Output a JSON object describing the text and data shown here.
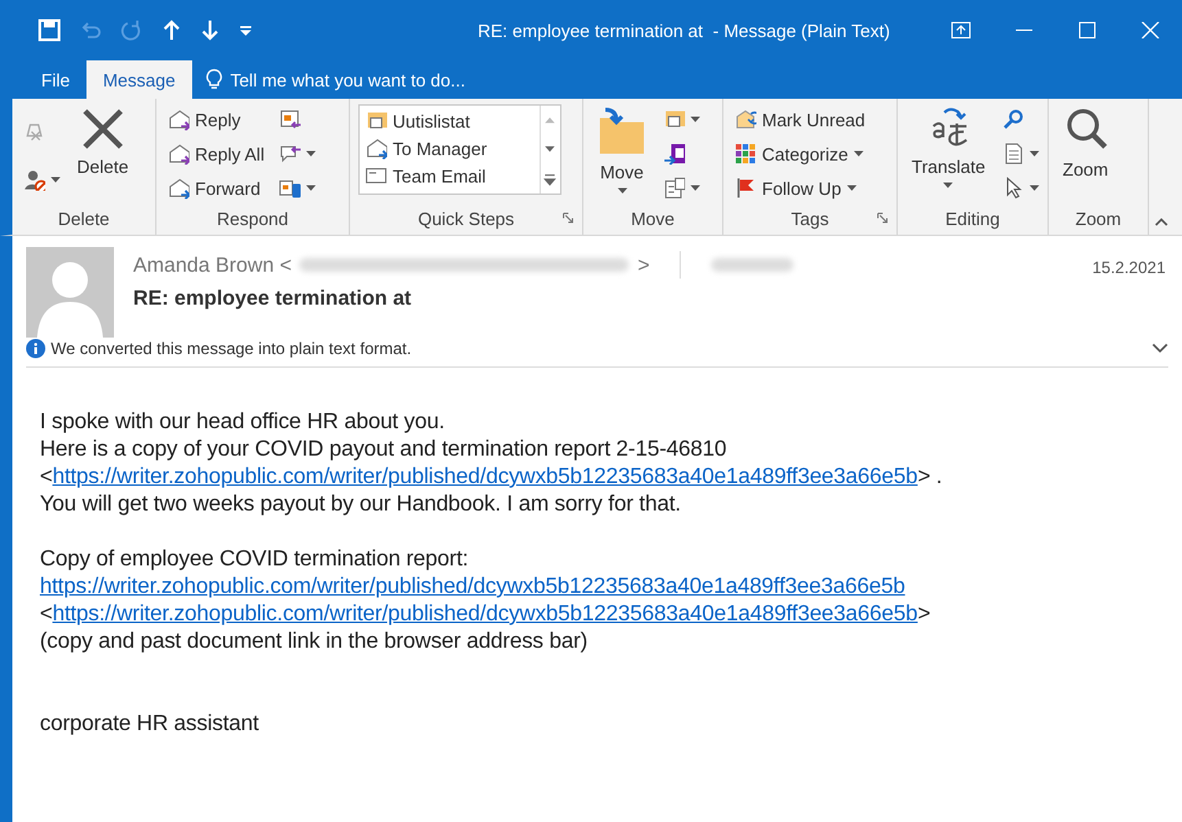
{
  "window": {
    "title": "RE: employee termination at  - Message (Plain Text)"
  },
  "tabs": [
    {
      "label": "File",
      "selected": false
    },
    {
      "label": "Message",
      "selected": true
    }
  ],
  "tell_me": {
    "placeholder": "Tell me what you want to do..."
  },
  "ribbon": {
    "groups": [
      {
        "label": "Delete",
        "buttons": [
          "Delete"
        ]
      },
      {
        "label": "Respond",
        "buttons": [
          "Reply",
          "Reply All",
          "Forward"
        ]
      },
      {
        "label": "Quick Steps",
        "buttons": [
          "Uutislistat",
          "To Manager",
          "Team Email"
        ]
      },
      {
        "label": "Move",
        "buttons": [
          "Move"
        ]
      },
      {
        "label": "Tags",
        "buttons": [
          "Mark Unread",
          "Categorize",
          "Follow Up"
        ]
      },
      {
        "label": "Editing",
        "buttons": [
          "Translate"
        ]
      },
      {
        "label": "Zoom",
        "buttons": [
          "Zoom"
        ]
      }
    ]
  },
  "message": {
    "sender": "Amanda Brown <",
    "sender_end": ">",
    "date": "15.2.2021",
    "subject": "RE: employee termination at",
    "info": "We converted this message into plain text format."
  },
  "body": {
    "paragraphs": [
      [
        [
          {
            "kind": "text",
            "text": "I spoke with our head office HR about you."
          }
        ],
        [
          {
            "kind": "text",
            "text": "Here is a copy of your COVID payout and termination report 2-15-46810"
          }
        ],
        [
          {
            "kind": "text",
            "text": "<"
          },
          {
            "kind": "link",
            "text": "https://writer.zohopublic.com/writer/published/dcywxb5b12235683a40e1a489ff3ee3a66e5b"
          },
          {
            "kind": "text",
            "text": "> ."
          }
        ],
        [
          {
            "kind": "text",
            "text": "You will get two weeks payout by our Handbook. I am sorry for that."
          }
        ]
      ],
      [
        [
          {
            "kind": "text",
            "text": "Copy of employee COVID termination report:"
          }
        ],
        [
          {
            "kind": "link",
            "text": "https://writer.zohopublic.com/writer/published/dcywxb5b12235683a40e1a489ff3ee3a66e5b"
          }
        ],
        [
          {
            "kind": "text",
            "text": "<"
          },
          {
            "kind": "link",
            "text": "https://writer.zohopublic.com/writer/published/dcywxb5b12235683a40e1a489ff3ee3a66e5b"
          },
          {
            "kind": "text",
            "text": ">"
          }
        ],
        [
          {
            "kind": "text",
            "text": "(copy and past document link in the browser address bar)"
          }
        ]
      ],
      [
        [
          {
            "kind": "text",
            "text": "corporate HR assistant"
          }
        ]
      ]
    ]
  }
}
